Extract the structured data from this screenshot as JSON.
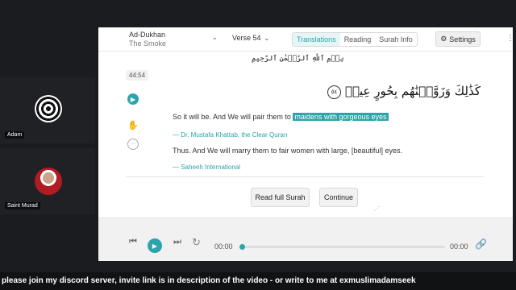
{
  "participants": [
    {
      "name": "Adam"
    },
    {
      "name": "Saint Murad"
    }
  ],
  "app": {
    "surah": {
      "name": "Ad-Dukhan",
      "translation": "The Smoke"
    },
    "verse": "Verse 54",
    "tabs": [
      "Translations",
      "Reading",
      "Surah Info"
    ],
    "active_tab": "Translations",
    "settings_label": "Settings",
    "bismillah": "بِسۡمِ ٱللَّهِ ٱلرَّحۡمَٰنِ ٱلرَّحِيمِ",
    "verse_key": "44:54",
    "arabic_text": "كَذَٰلِكَ وَزَوَّجۡنَٰهُم بِحُورٍ عِينٖ",
    "ayah_number": "٥٤",
    "translation1": {
      "prefix": "So it will be. And We will pair them to",
      "highlight": "maidens with gorgeous eyes",
      "author": "— Dr. Mustafa Khattab, the Clear Quran"
    },
    "translation2": {
      "text": "Thus. And We will marry them to fair women with large, [beautiful] eyes.",
      "author": "— Saheeh International"
    },
    "read_full_label": "Read full Surah",
    "continue_label": "Continue"
  },
  "player": {
    "time_start": "00:00",
    "time_end": "00:00",
    "progress": 0
  },
  "ticker": "please join my discord server, invite link is in description of the video - or write to me at exmuslimadamseek"
}
